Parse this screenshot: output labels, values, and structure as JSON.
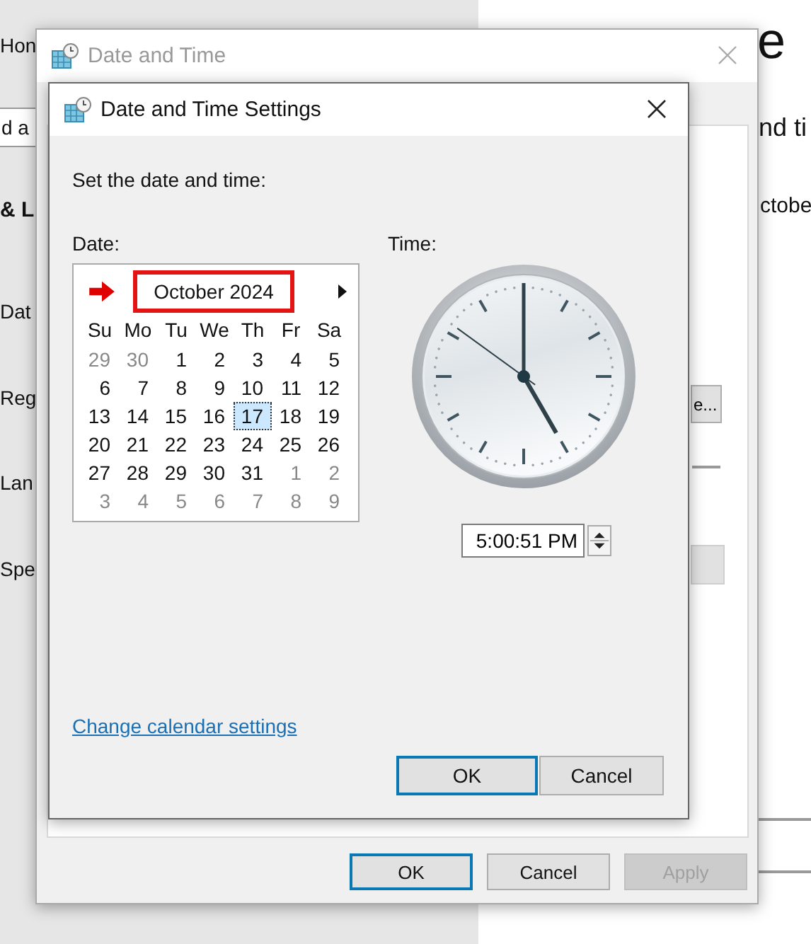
{
  "background_settings": {
    "nav_top": "Hon",
    "search_fragment": "d a",
    "section_fragment": "& L",
    "nav_items": [
      "Dat",
      "Reg",
      "Lan",
      "Spe"
    ],
    "heading_fragment": "e",
    "subheading_fragment": "nd ti",
    "date_fragment": "ctobe"
  },
  "date_time_window": {
    "title": "Date and Time",
    "panel_button_fragment": "e...",
    "buttons": [
      {
        "label": "OK",
        "default": true,
        "disabled": false
      },
      {
        "label": "Cancel",
        "default": false,
        "disabled": false
      },
      {
        "label": "Apply",
        "default": false,
        "disabled": true
      }
    ]
  },
  "settings_dialog": {
    "title": "Date and Time Settings",
    "instruction": "Set the date and time:",
    "date_label": "Date:",
    "time_label": "Time:",
    "calendar": {
      "month_title": "October 2024",
      "month_title_annotated": true,
      "weekdays": [
        "Su",
        "Mo",
        "Tu",
        "We",
        "Th",
        "Fr",
        "Sa"
      ],
      "weeks": [
        [
          {
            "day": "29",
            "other_month": true,
            "selected": false
          },
          {
            "day": "30",
            "other_month": true,
            "selected": false
          },
          {
            "day": "1",
            "other_month": false,
            "selected": false
          },
          {
            "day": "2",
            "other_month": false,
            "selected": false
          },
          {
            "day": "3",
            "other_month": false,
            "selected": false
          },
          {
            "day": "4",
            "other_month": false,
            "selected": false
          },
          {
            "day": "5",
            "other_month": false,
            "selected": false
          }
        ],
        [
          {
            "day": "6",
            "other_month": false,
            "selected": false
          },
          {
            "day": "7",
            "other_month": false,
            "selected": false
          },
          {
            "day": "8",
            "other_month": false,
            "selected": false
          },
          {
            "day": "9",
            "other_month": false,
            "selected": false
          },
          {
            "day": "10",
            "other_month": false,
            "selected": false
          },
          {
            "day": "11",
            "other_month": false,
            "selected": false
          },
          {
            "day": "12",
            "other_month": false,
            "selected": false
          }
        ],
        [
          {
            "day": "13",
            "other_month": false,
            "selected": false
          },
          {
            "day": "14",
            "other_month": false,
            "selected": false
          },
          {
            "day": "15",
            "other_month": false,
            "selected": false
          },
          {
            "day": "16",
            "other_month": false,
            "selected": false
          },
          {
            "day": "17",
            "other_month": false,
            "selected": true
          },
          {
            "day": "18",
            "other_month": false,
            "selected": false
          },
          {
            "day": "19",
            "other_month": false,
            "selected": false
          }
        ],
        [
          {
            "day": "20",
            "other_month": false,
            "selected": false
          },
          {
            "day": "21",
            "other_month": false,
            "selected": false
          },
          {
            "day": "22",
            "other_month": false,
            "selected": false
          },
          {
            "day": "23",
            "other_month": false,
            "selected": false
          },
          {
            "day": "24",
            "other_month": false,
            "selected": false
          },
          {
            "day": "25",
            "other_month": false,
            "selected": false
          },
          {
            "day": "26",
            "other_month": false,
            "selected": false
          }
        ],
        [
          {
            "day": "27",
            "other_month": false,
            "selected": false
          },
          {
            "day": "28",
            "other_month": false,
            "selected": false
          },
          {
            "day": "29",
            "other_month": false,
            "selected": false
          },
          {
            "day": "30",
            "other_month": false,
            "selected": false
          },
          {
            "day": "31",
            "other_month": false,
            "selected": false
          },
          {
            "day": "1",
            "other_month": true,
            "selected": false
          },
          {
            "day": "2",
            "other_month": true,
            "selected": false
          }
        ],
        [
          {
            "day": "3",
            "other_month": true,
            "selected": false
          },
          {
            "day": "4",
            "other_month": true,
            "selected": false
          },
          {
            "day": "5",
            "other_month": true,
            "selected": false
          },
          {
            "day": "6",
            "other_month": true,
            "selected": false
          },
          {
            "day": "7",
            "other_month": true,
            "selected": false
          },
          {
            "day": "8",
            "other_month": true,
            "selected": false
          },
          {
            "day": "9",
            "other_month": true,
            "selected": false
          }
        ]
      ]
    },
    "time_value": "5:00:51 PM",
    "link": "Change calendar settings",
    "buttons": [
      {
        "label": "OK",
        "default": true
      },
      {
        "label": "Cancel",
        "default": false
      }
    ]
  }
}
